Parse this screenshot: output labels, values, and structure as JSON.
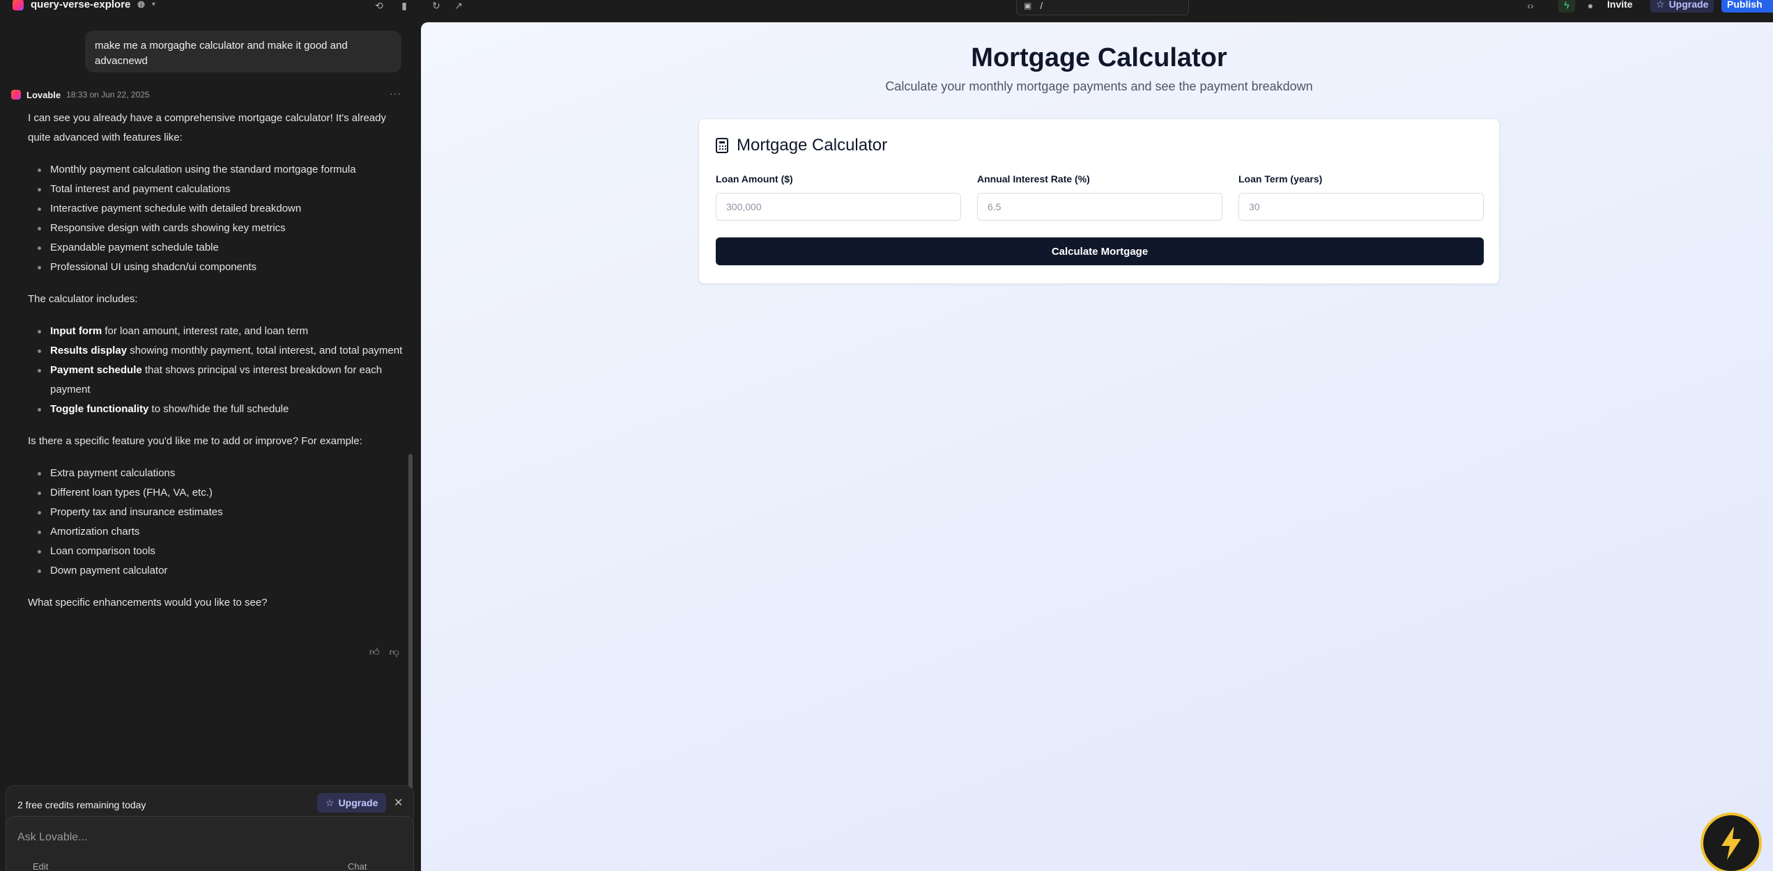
{
  "topbar": {
    "project_name": "query-verse-explore",
    "url_path": "/",
    "invite_label": "Invite",
    "upgrade_label": "Upgrade",
    "publish_label": "Publish"
  },
  "chat": {
    "user_message": "make me a morgaghe calculator and make it good and advacnewd",
    "assistant": {
      "author": "Lovable",
      "time": "18:33 on Jun 22, 2025",
      "intro": "I can see you already have a comprehensive mortgage calculator! It's already quite advanced with features like:",
      "features": [
        "Monthly payment calculation using the standard mortgage formula",
        "Total interest and payment calculations",
        "Interactive payment schedule with detailed breakdown",
        "Responsive design with cards showing key metrics",
        "Expandable payment schedule table",
        "Professional UI using shadcn/ui components"
      ],
      "includes_heading": "The calculator includes:",
      "includes": [
        {
          "bold": "Input form",
          "text": " for loan amount, interest rate, and loan term"
        },
        {
          "bold": "Results display",
          "text": " showing monthly payment, total interest, and total payment"
        },
        {
          "bold": "Payment schedule",
          "text": " that shows principal vs interest breakdown for each payment"
        },
        {
          "bold": "Toggle functionality",
          "text": " to show/hide the full schedule"
        }
      ],
      "question": "Is there a specific feature you'd like me to add or improve? For example:",
      "suggestions": [
        "Extra payment calculations",
        "Different loan types (FHA, VA, etc.)",
        "Property tax and insurance estimates",
        "Amortization charts",
        "Loan comparison tools",
        "Down payment calculator"
      ],
      "closing": "What specific enhancements would you like to see?"
    },
    "credits_text": "2 free credits remaining today",
    "credits_upgrade_label": "Upgrade",
    "input_placeholder": "Ask Lovable...",
    "input_edit_label": "Edit",
    "input_chat_label": "Chat"
  },
  "preview": {
    "title": "Mortgage Calculator",
    "subtitle": "Calculate your monthly mortgage payments and see the payment breakdown",
    "card_title": "Mortgage Calculator",
    "fields": [
      {
        "label": "Loan Amount ($)",
        "placeholder": "300,000"
      },
      {
        "label": "Annual Interest Rate (%)",
        "placeholder": "6.5"
      },
      {
        "label": "Loan Term (years)",
        "placeholder": "30"
      }
    ],
    "button_label": "Calculate Mortgage"
  },
  "colors": {
    "primary": "#0f172a",
    "publish": "#2563eb",
    "accent_bolt": "#f2c230"
  }
}
